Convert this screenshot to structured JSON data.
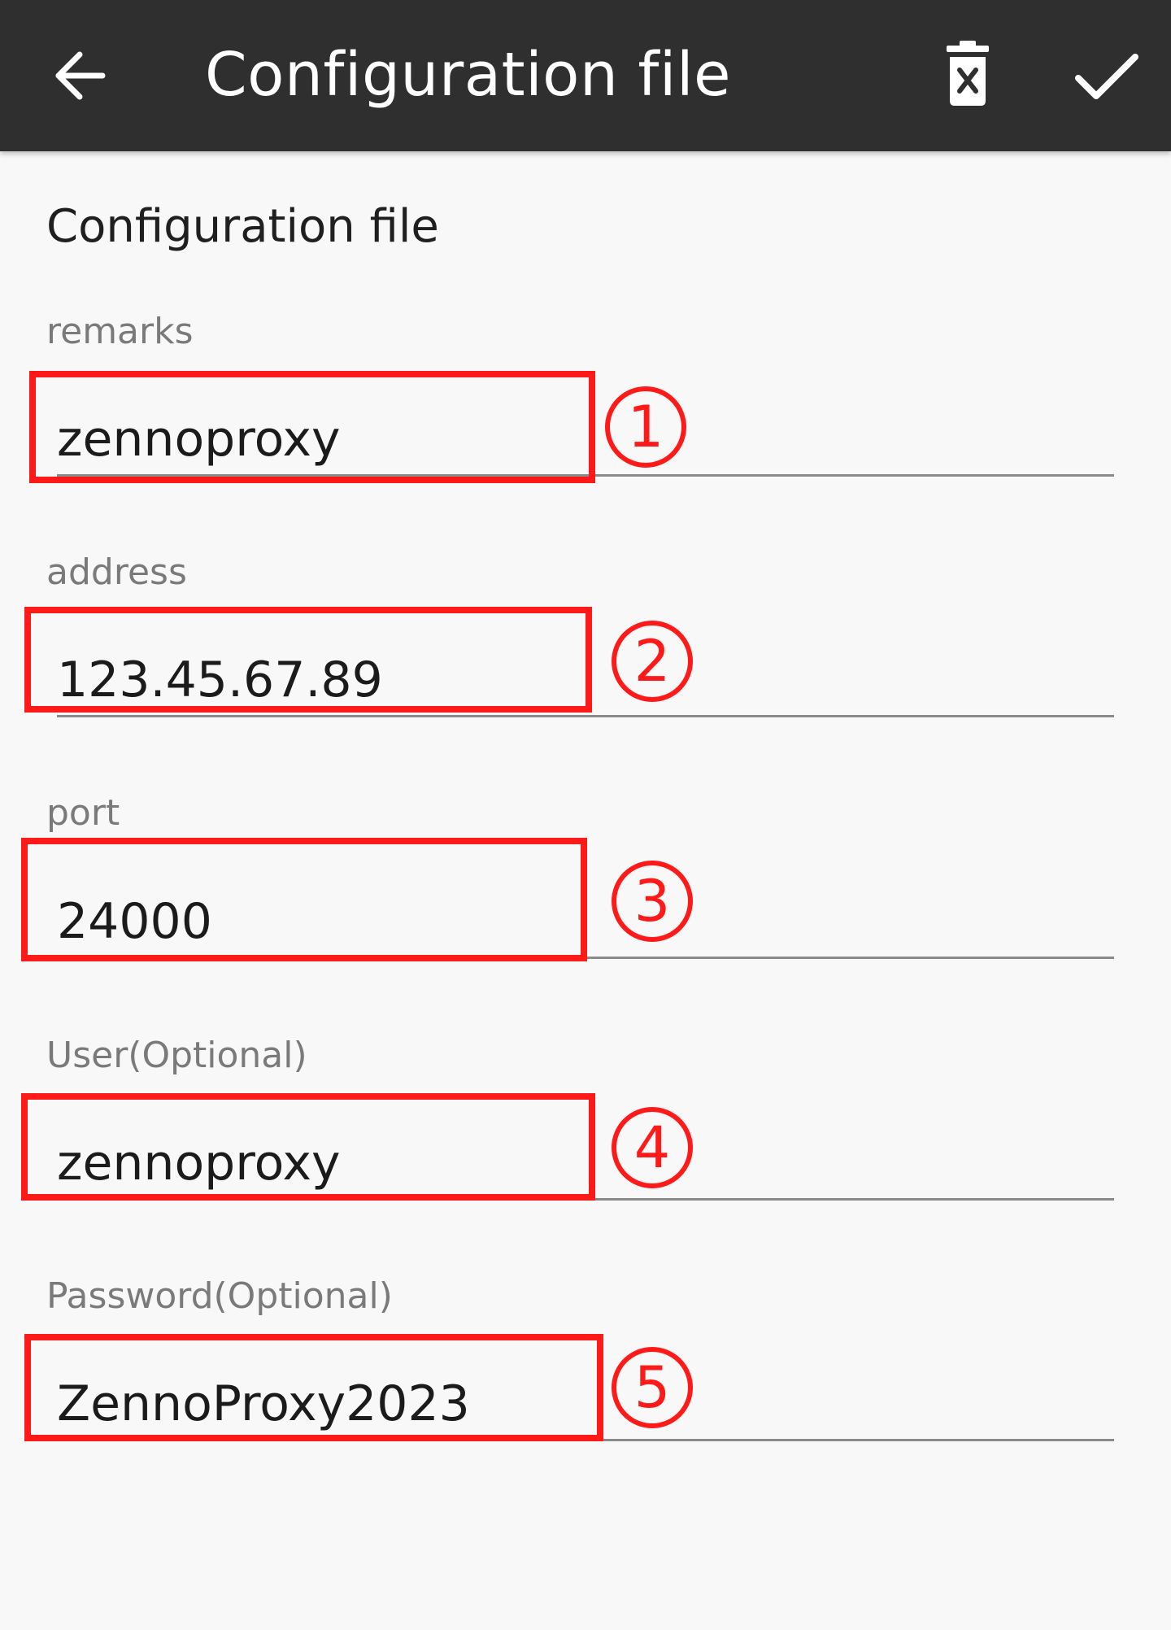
{
  "appbar": {
    "title": "Configuration file",
    "back_icon": "arrow-left-icon",
    "delete_icon": "delete-icon",
    "confirm_icon": "check-icon",
    "background": "#2f2f2f"
  },
  "section": {
    "title": "Configuration file"
  },
  "fields": {
    "remarks": {
      "label": "remarks",
      "value": "zennoproxy"
    },
    "address": {
      "label": "address",
      "value": "123.45.67.89"
    },
    "port": {
      "label": "port",
      "value": "24000"
    },
    "user": {
      "label": "User(Optional)",
      "value": "zennoproxy"
    },
    "password": {
      "label": "Password(Optional)",
      "value": "ZennoProxy2023"
    }
  },
  "annotations": {
    "color": "#ff1a1a",
    "numbers": [
      "1",
      "2",
      "3",
      "4",
      "5"
    ]
  }
}
